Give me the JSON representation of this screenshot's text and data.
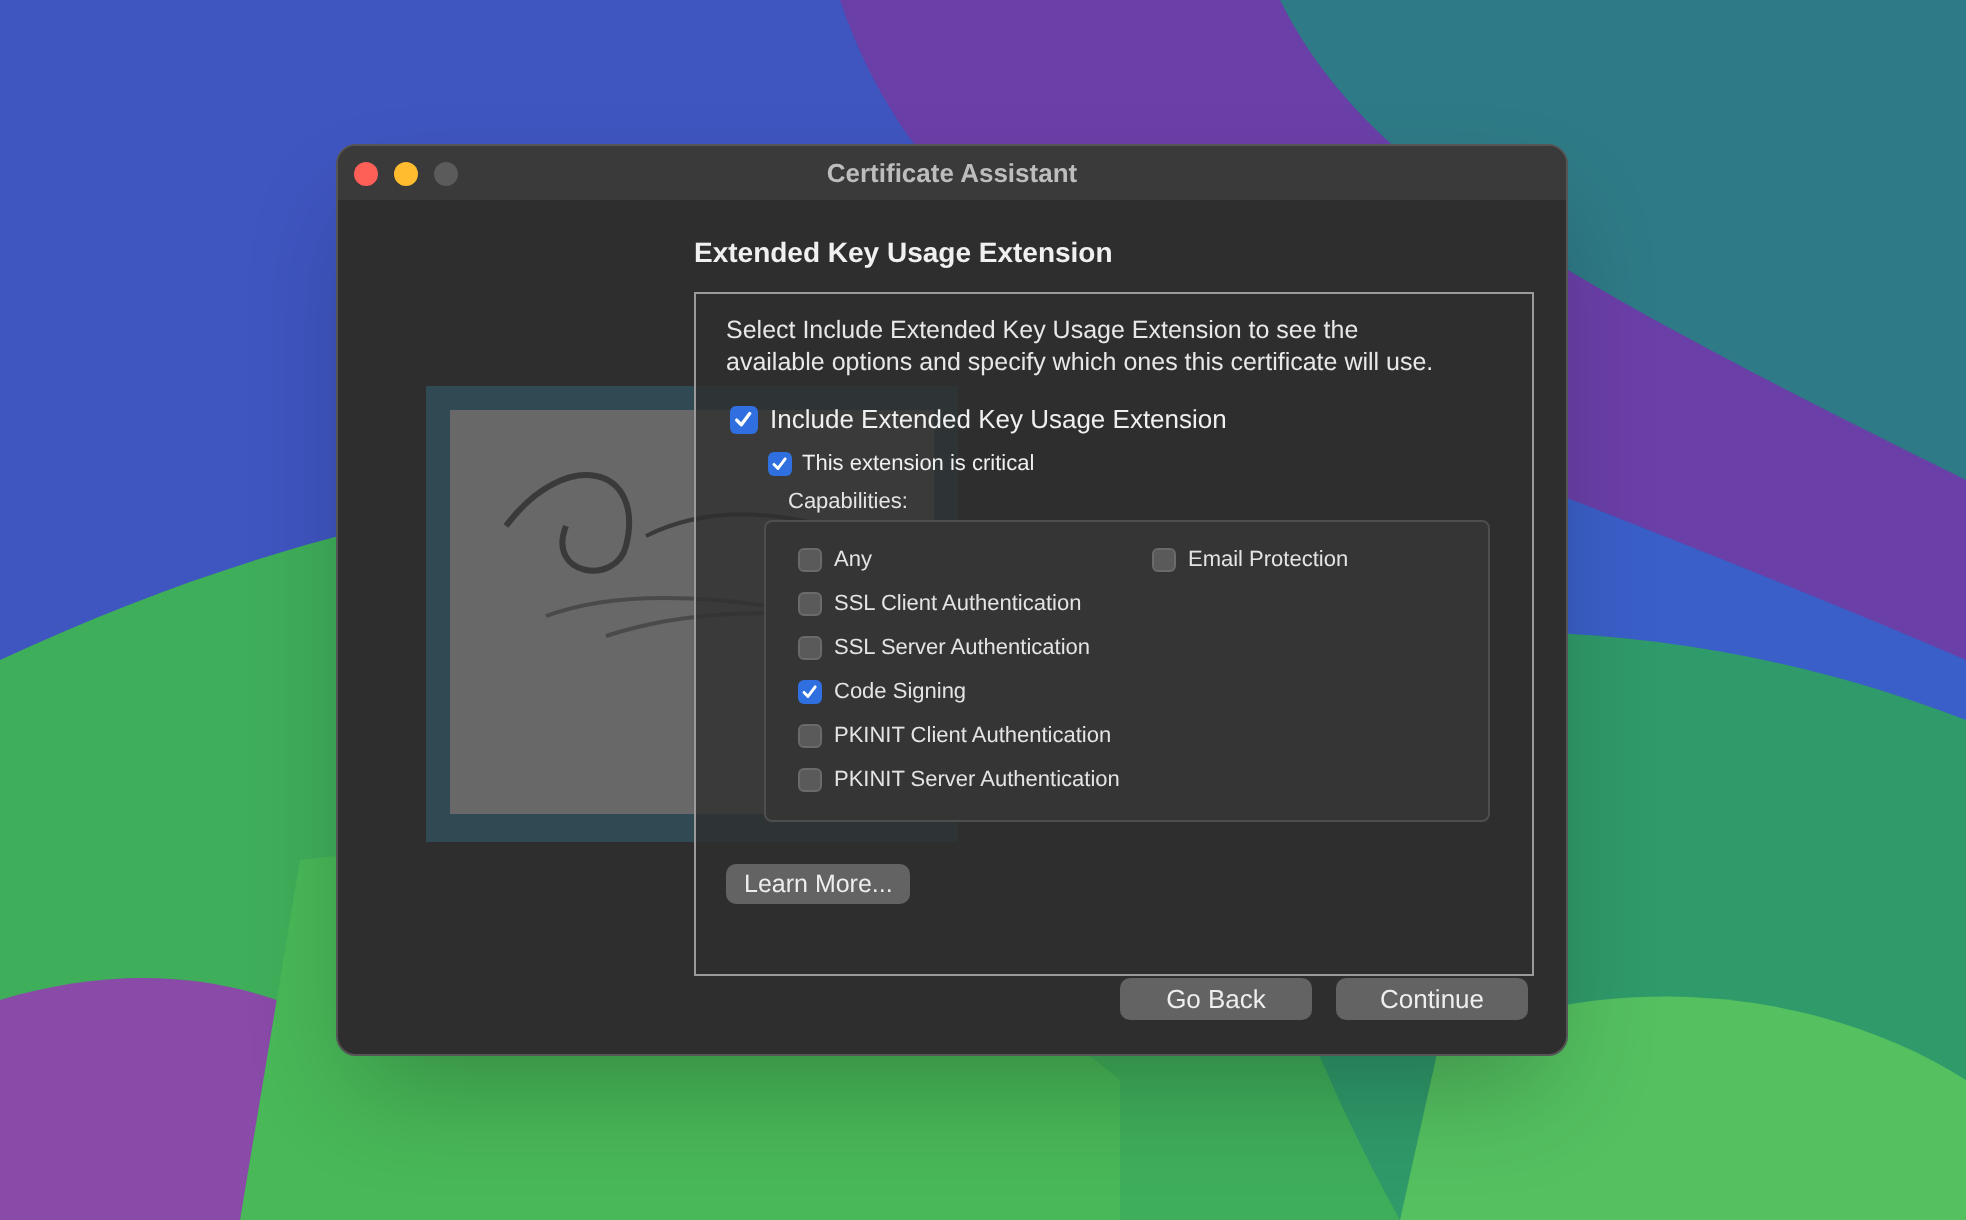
{
  "window": {
    "title": "Certificate Assistant"
  },
  "heading": "Extended Key Usage Extension",
  "description": "Select Include Extended Key Usage Extension to see the available options and specify which ones this certificate will use.",
  "include_extension": {
    "label": "Include Extended Key Usage Extension",
    "checked": true
  },
  "critical": {
    "label": "This extension is critical",
    "checked": true
  },
  "capabilities": {
    "label": "Capabilities:",
    "left": [
      {
        "label": "Any",
        "checked": false
      },
      {
        "label": "SSL Client Authentication",
        "checked": false
      },
      {
        "label": "SSL Server Authentication",
        "checked": false
      },
      {
        "label": "Code Signing",
        "checked": true
      },
      {
        "label": "PKINIT Client Authentication",
        "checked": false
      },
      {
        "label": "PKINIT Server Authentication",
        "checked": false
      }
    ],
    "right": [
      {
        "label": "Email Protection",
        "checked": false
      }
    ]
  },
  "learn_more": "Learn More...",
  "buttons": [
    "Go Back",
    "Continue"
  ]
}
